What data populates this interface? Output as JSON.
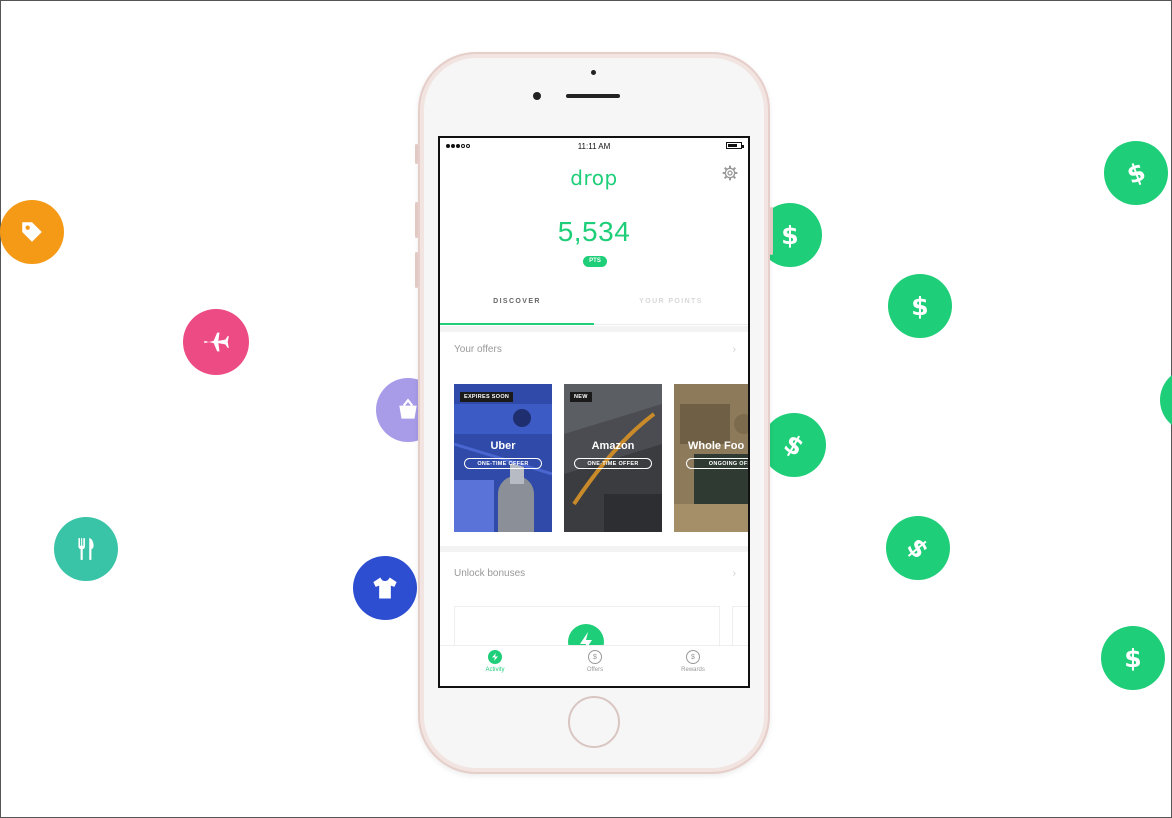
{
  "status_bar": {
    "time": "11:11 AM"
  },
  "app": {
    "logo": "drop",
    "points_value": "5,534",
    "points_badge": "PTS"
  },
  "tabs": [
    {
      "label": "DISCOVER",
      "active": true
    },
    {
      "label": "YOUR POINTS",
      "active": false
    }
  ],
  "sections": {
    "offers": {
      "title": "Your offers",
      "chevron": "›"
    },
    "bonuses": {
      "title": "Unlock bonuses",
      "chevron": "›"
    }
  },
  "offers": [
    {
      "tag": "EXPIRES SOON",
      "name": "Uber",
      "type": "ONE-TIME OFFER"
    },
    {
      "tag": "NEW",
      "name": "Amazon",
      "type": "ONE-TIME OFFER"
    },
    {
      "tag": "",
      "name": "Whole Foo",
      "type": "ONGOING OFFE"
    }
  ],
  "bottom_nav": [
    {
      "label": "Activity",
      "icon": "bolt-icon",
      "active": true
    },
    {
      "label": "Offers",
      "icon": "dollar-icon",
      "active": false
    },
    {
      "label": "Rewards",
      "icon": "dollar-icon",
      "active": false
    }
  ],
  "colors": {
    "brand_green": "#1fce78",
    "tag_orange": "#f49a17",
    "plane_pink": "#ec4c83",
    "food_teal": "#39c3a7",
    "shirt_blue": "#2d4ed0",
    "basket_lavender": "#a89ce8"
  },
  "floating_icons": [
    "tag-icon",
    "plane-icon",
    "fork-knife-icon",
    "basket-icon",
    "shirt-icon",
    "dollar-icon"
  ]
}
